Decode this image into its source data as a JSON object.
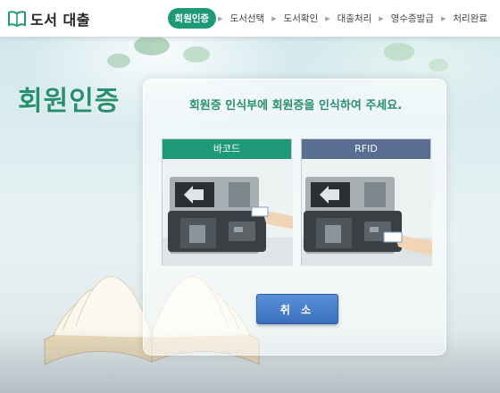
{
  "app": {
    "title": "도서 대출"
  },
  "steps": [
    {
      "label": "회원인증",
      "active": true
    },
    {
      "label": "도서선택",
      "active": false
    },
    {
      "label": "도서확인",
      "active": false
    },
    {
      "label": "대출처리",
      "active": false
    },
    {
      "label": "영수증발급",
      "active": false
    },
    {
      "label": "처리완료",
      "active": false
    }
  ],
  "page": {
    "title": "회원인증"
  },
  "panel": {
    "instruction": "회원증 인식부에 회원증을 인식하여 주세요.",
    "options": [
      {
        "label": "바코드",
        "icon": "barcode-scanner-illustration"
      },
      {
        "label": "RFID",
        "icon": "rfid-reader-illustration"
      }
    ],
    "cancel_label": "취 소"
  },
  "colors": {
    "accent": "#1f9a78",
    "title": "#2a8f6d",
    "rfid_header": "#5a6e94",
    "button": "#3a6fc0"
  }
}
